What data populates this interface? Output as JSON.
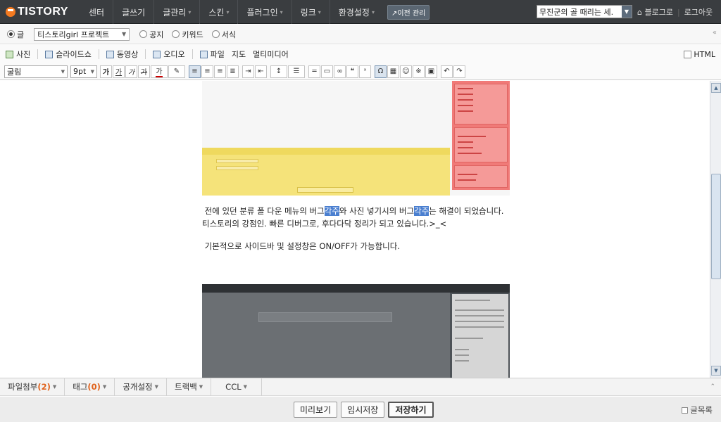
{
  "topbar": {
    "logo": "TISTORY",
    "nav": [
      {
        "label": "센터",
        "caret": false
      },
      {
        "label": "글쓰기",
        "caret": false
      },
      {
        "label": "글관리",
        "caret": true
      },
      {
        "label": "스킨",
        "caret": true
      },
      {
        "label": "플러그인",
        "caret": true
      },
      {
        "label": "링크",
        "caret": true
      },
      {
        "label": "환경설정",
        "caret": true
      }
    ],
    "old_admin": "이전 관리",
    "blog_select": "무진군의 골 때리는 세.",
    "blog_link": "블로그로",
    "logout": "로그아웃"
  },
  "typerow": {
    "post_label": "글",
    "category": "티스토리girl 프로젝트",
    "notice": "공지",
    "keyword": "키워드",
    "template": "서식"
  },
  "insert": {
    "photo": "사진",
    "slideshow": "슬라이드쇼",
    "video": "동영상",
    "audio": "오디오",
    "file": "파일",
    "map": "지도",
    "multimedia": "멀티미디어",
    "html": "HTML"
  },
  "format": {
    "font": "굴림",
    "size": "9pt"
  },
  "content": {
    "p1_a": "전에 있던 분류 폴 다운 메뉴의 버그",
    "hl1": "각주",
    "p1_b": "와 사진 넣기시의 버그",
    "hl2": "각주",
    "p1_c": "는 해결이 되었습니다. 티스토리의 강점인. 빠른 디버그로, 후다다닥 정리가 되고 있습니다.>_<",
    "p2": "기본적으로 사이드바 및 설정창은 ON/OFF가 가능합니다."
  },
  "bottomtabs": {
    "attach_label": "파일첨부",
    "attach_count": "(2)",
    "tag_label": "태그",
    "tag_count": "(0)",
    "publish": "공개설정",
    "trackback": "트랙백",
    "ccl": "CCL"
  },
  "footer": {
    "preview": "미리보기",
    "draft": "임시저장",
    "save": "저장하기",
    "list": "글목록"
  },
  "colors": {
    "topbar": "#3a3d40",
    "highlight": "#4a7fd0",
    "count": "#e0621c"
  }
}
